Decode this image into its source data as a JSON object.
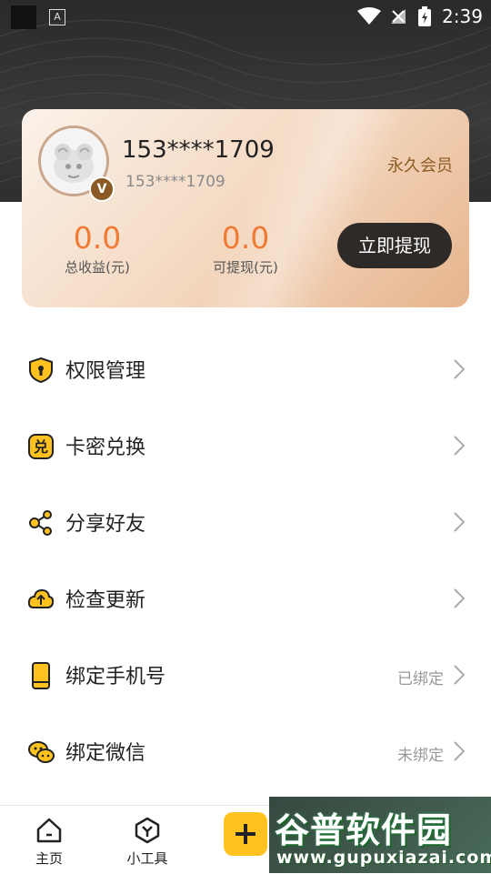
{
  "status_bar": {
    "time": "2:39",
    "notification_letter": "A"
  },
  "profile": {
    "username": "153****1709",
    "sub_name": "153****1709",
    "membership": "永久会员",
    "avatar_badge": "V",
    "stats": [
      {
        "value": "0.0",
        "label": "总收益(元)"
      },
      {
        "value": "0.0",
        "label": "可提现(元)"
      }
    ],
    "withdraw_button": "立即提现"
  },
  "menu": {
    "items": [
      {
        "label": "权限管理",
        "icon": "shield-icon",
        "status": ""
      },
      {
        "label": "卡密兑换",
        "icon": "redeem-icon",
        "status": ""
      },
      {
        "label": "分享好友",
        "icon": "share-icon",
        "status": ""
      },
      {
        "label": "检查更新",
        "icon": "cloud-upload-icon",
        "status": ""
      },
      {
        "label": "绑定手机号",
        "icon": "phone-icon",
        "status": "已绑定"
      },
      {
        "label": "绑定微信",
        "icon": "wechat-icon",
        "status": "未绑定"
      }
    ]
  },
  "bottom_nav": {
    "items": [
      {
        "label": "主页",
        "icon": "home-icon"
      },
      {
        "label": "小工具",
        "icon": "tools-icon"
      }
    ]
  },
  "watermark": {
    "title": "谷普软件园",
    "url": "www.gupuxiazai.com"
  },
  "colors": {
    "accent": "#ffc21f",
    "stat_value": "#ef7b35",
    "member_text": "#8d5c24",
    "button_dark": "#2e2a28"
  }
}
